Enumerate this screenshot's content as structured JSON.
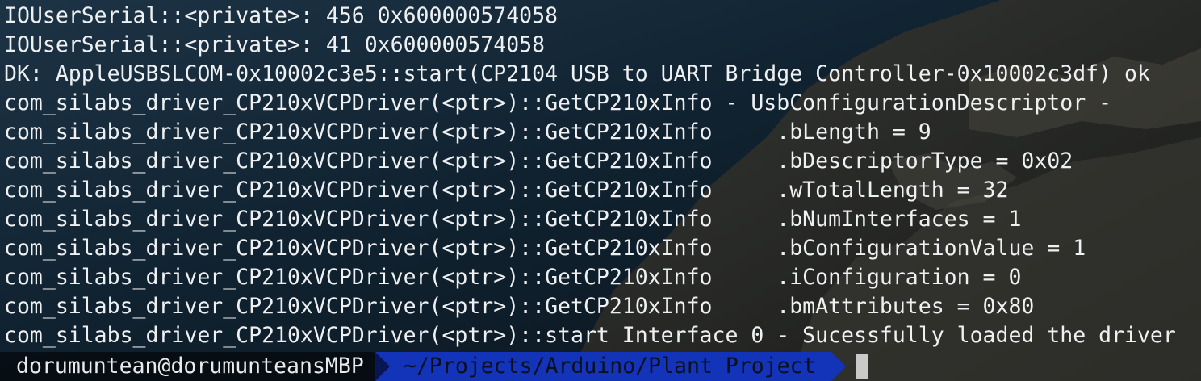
{
  "terminal": {
    "lines": [
      "IOUserSerial::<private>: 456 0x600000574058",
      "IOUserSerial::<private>: 41 0x600000574058",
      "DK: AppleUSBSLCOM-0x10002c3e5::start(CP2104 USB to UART Bridge Controller-0x10002c3df) ok",
      "com_silabs_driver_CP210xVCPDriver(<ptr>)::GetCP210xInfo - UsbConfigurationDescriptor -",
      "com_silabs_driver_CP210xVCPDriver(<ptr>)::GetCP210xInfo     .bLength = 9",
      "com_silabs_driver_CP210xVCPDriver(<ptr>)::GetCP210xInfo     .bDescriptorType = 0x02",
      "com_silabs_driver_CP210xVCPDriver(<ptr>)::GetCP210xInfo     .wTotalLength = 32",
      "com_silabs_driver_CP210xVCPDriver(<ptr>)::GetCP210xInfo     .bNumInterfaces = 1",
      "com_silabs_driver_CP210xVCPDriver(<ptr>)::GetCP210xInfo     .bConfigurationValue = 1",
      "com_silabs_driver_CP210xVCPDriver(<ptr>)::GetCP210xInfo     .iConfiguration = 0",
      "com_silabs_driver_CP210xVCPDriver(<ptr>)::GetCP210xInfo     .bmAttributes = 0x80",
      "com_silabs_driver_CP210xVCPDriver(<ptr>)::start Interface 0 - Sucessfully loaded the driver"
    ],
    "text_color": "#eef0f2"
  },
  "prompt": {
    "user_host": "dorumuntean@dorumunteansMBP",
    "path": "~/Projects/Arduino/Plant Project",
    "path_bg": "#1334b8",
    "cursor_color": "#c9c9c9"
  }
}
